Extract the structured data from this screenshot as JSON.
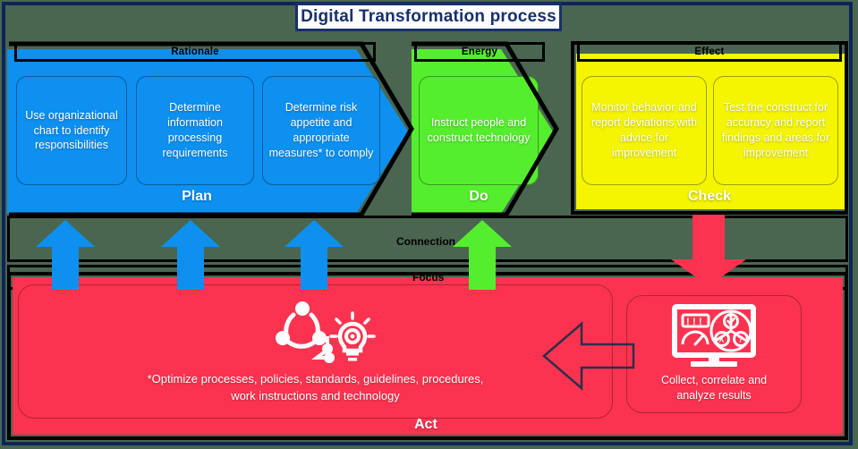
{
  "title": "Digital Transformation process",
  "colors": {
    "plan": "#0d90f0",
    "do": "#55ee2e",
    "check": "#f5f500",
    "act": "#fb3350",
    "frame_navy": "#0d2559",
    "background": "#4a6650",
    "outline_black": "#000000"
  },
  "bands": {
    "connection_label": "Connection",
    "focus_label": "Focus"
  },
  "phases": [
    {
      "header": "Rationale",
      "label": "Plan",
      "color_key": "plan",
      "cards": [
        "Use organizational chart to identify responsibilities",
        "Determine information processing requirements",
        "Determine risk appetite and appropriate measures* to comply"
      ]
    },
    {
      "header": "Energy",
      "label": "Do",
      "color_key": "do",
      "cards": [
        "Instruct people and construct technology"
      ]
    },
    {
      "header": "Effect",
      "label": "Check",
      "color_key": "check",
      "cards": [
        "Monitor behavior and report deviations with advice for improvement",
        "Test the construct for accuracy and report findings and areas for improvement"
      ]
    }
  ],
  "act": {
    "label": "Act",
    "optimize_line1": "*Optimize processes, policies, standards, guidelines, procedures,",
    "optimize_line2": "work instructions and technology",
    "optimize_icon": "network-lightbulb-icon",
    "collect_line1": "Collect, correlate and",
    "collect_line2": "analyze results",
    "collect_icon": "dashboard-monitor-icon",
    "flow_arrow_icon": "arrow-left-icon"
  },
  "arrows": {
    "plan_up_icon": "arrow-up-icon",
    "do_up_icon": "arrow-up-icon",
    "check_down_icon": "arrow-down-icon",
    "plan_chevron_icon": "chevron-right-icon",
    "do_chevron_icon": "chevron-right-icon"
  }
}
